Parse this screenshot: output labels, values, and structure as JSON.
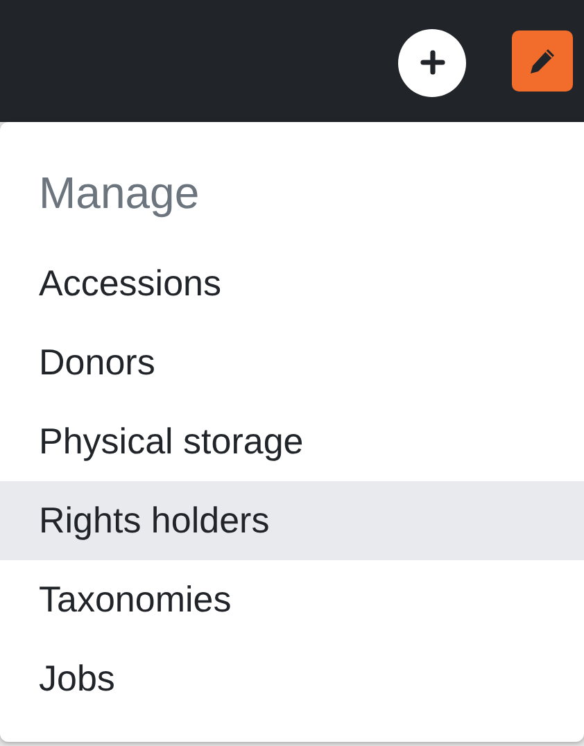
{
  "toolbar": {
    "buttons": [
      {
        "kind": "add"
      },
      {
        "kind": "edit"
      }
    ]
  },
  "menu": {
    "heading": "Manage",
    "items": [
      {
        "label": "Accessions",
        "selected": false
      },
      {
        "label": "Donors",
        "selected": false
      },
      {
        "label": "Physical storage",
        "selected": false
      },
      {
        "label": "Rights holders",
        "selected": true
      },
      {
        "label": "Taxonomies",
        "selected": false
      },
      {
        "label": "Jobs",
        "selected": false
      }
    ]
  }
}
